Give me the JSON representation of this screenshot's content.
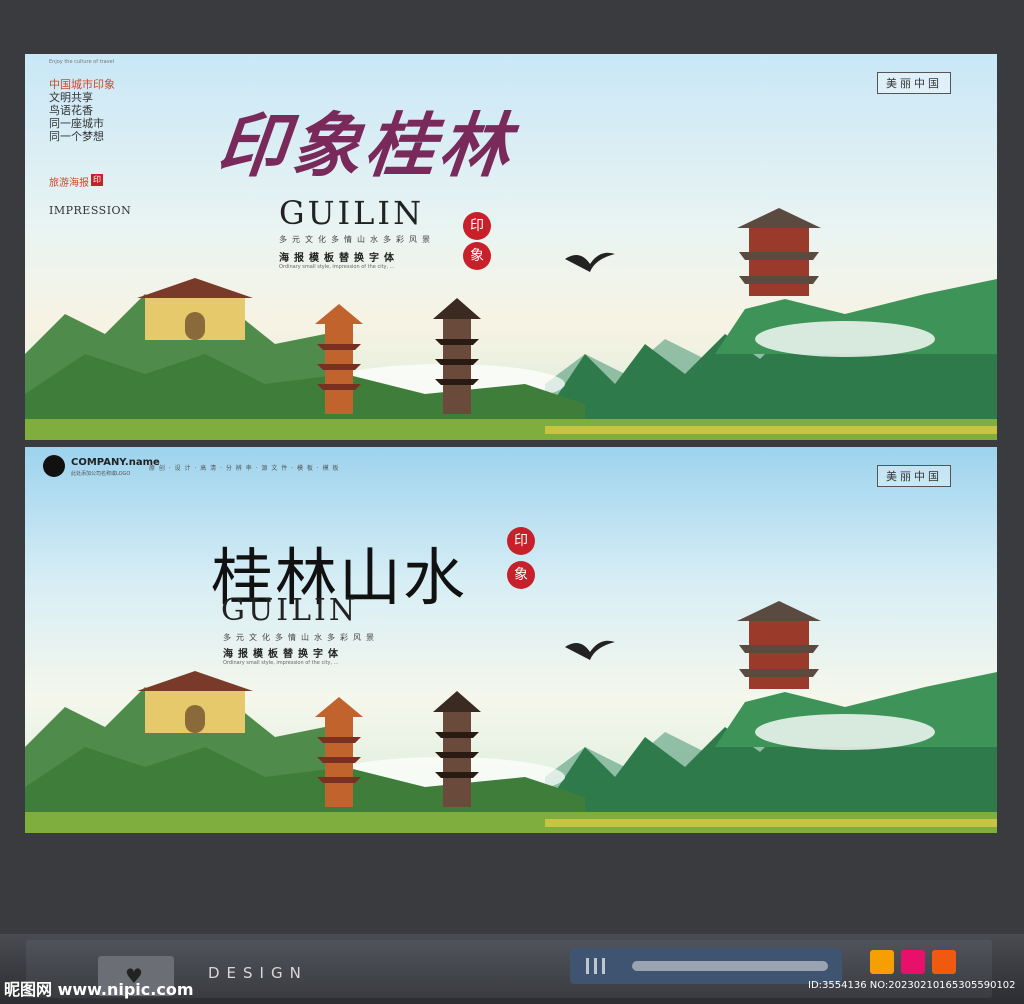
{
  "poster1": {
    "side_text": {
      "tiny_top": "Enjoy the culture of travel",
      "lines": [
        "中国城市印象",
        "文明共享",
        "鸟语花香",
        "同一座城市",
        "同一个梦想"
      ],
      "label": "旅游海报",
      "seal_char": "印",
      "impression": "IMPRESSION"
    },
    "title_cn": "印象桂林",
    "title_en": "GUILIN",
    "seal_top": "印",
    "seal_bottom": "象",
    "sub1": "多元文化多情山水多彩风景",
    "sub2": "海报模板替换字体",
    "body": "Ordinary small style, impression of the city, ...",
    "tag": "美丽中国"
  },
  "poster2": {
    "company": "COMPANY.name",
    "company_sub": "此处添加公司名称或LOGO",
    "nav": "原 创 · 设 计 · 高 清 · 分 辨 率 · 源 文 件 · 模 板 · 模 板",
    "title_cn": "桂林山水",
    "title_en": "GUILIN",
    "seal_top": "印",
    "seal_bottom": "象",
    "sub1": "多元文化多情山水多彩风景",
    "sub2": "海报模板替换字体",
    "body": "Ordinary small style, impression of the city, ...",
    "tag": "美丽中国"
  },
  "footer": {
    "design_word": "DESIGN",
    "watermark_site": "昵图网 www.nipic.com",
    "id_text": "ID:3554136 NO:20230210165305590102",
    "swatches": [
      "#f5a000",
      "#e8106a",
      "#f05a10"
    ]
  }
}
